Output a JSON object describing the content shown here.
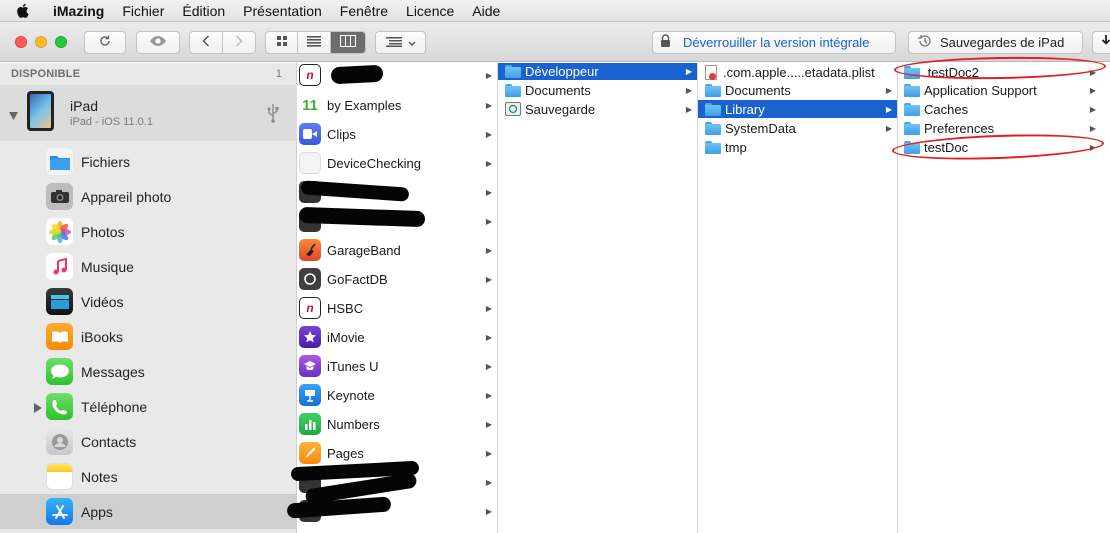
{
  "menubar": {
    "items": [
      "iMazing",
      "Fichier",
      "Édition",
      "Présentation",
      "Fenêtre",
      "Licence",
      "Aide"
    ]
  },
  "toolbar": {
    "unlock_label": "Déverrouiller la version intégrale",
    "backups_label": "Sauvegardes de iPad",
    "colors": {
      "accent": "#1a62cf",
      "close": "#fd5f57",
      "minimize": "#febc2e",
      "zoom": "#28c840"
    }
  },
  "sidebar": {
    "section_title": "DISPONIBLE",
    "count": "1",
    "device_name": "iPad",
    "device_subtitle": "iPad - iOS 11.0.1",
    "items": [
      {
        "label": "Fichiers",
        "icon": "files-icon"
      },
      {
        "label": "Appareil photo",
        "icon": "camera-icon"
      },
      {
        "label": "Photos",
        "icon": "photos-icon"
      },
      {
        "label": "Musique",
        "icon": "music-icon"
      },
      {
        "label": "Vidéos",
        "icon": "videos-icon"
      },
      {
        "label": "iBooks",
        "icon": "ibooks-icon"
      },
      {
        "label": "Messages",
        "icon": "messages-icon"
      },
      {
        "label": "Téléphone",
        "icon": "phone-icon"
      },
      {
        "label": "Contacts",
        "icon": "contacts-icon"
      },
      {
        "label": "Notes",
        "icon": "notes-icon"
      },
      {
        "label": "Apps",
        "icon": "appstore-icon"
      }
    ]
  },
  "columns": {
    "apps": [
      {
        "label": "",
        "icon": "n-app-icon"
      },
      {
        "label": "by Examples",
        "icon": "by-examples-icon"
      },
      {
        "label": "Clips",
        "icon": "clips-icon"
      },
      {
        "label": "DeviceChecking",
        "icon": "devicechecking-icon"
      },
      {
        "label": "",
        "icon": "redacted-app-icon"
      },
      {
        "label": "",
        "icon": "redacted-app-icon"
      },
      {
        "label": "GarageBand",
        "icon": "garageband-icon"
      },
      {
        "label": "GoFactDB",
        "icon": "gofactdb-icon"
      },
      {
        "label": "HSBC",
        "icon": "hsbc-icon"
      },
      {
        "label": "iMovie",
        "icon": "imovie-icon"
      },
      {
        "label": "iTunes U",
        "icon": "itunes-u-icon"
      },
      {
        "label": "Keynote",
        "icon": "keynote-icon"
      },
      {
        "label": "Numbers",
        "icon": "numbers-icon"
      },
      {
        "label": "Pages",
        "icon": "pages-icon"
      },
      {
        "label": "",
        "icon": "redacted-app-icon"
      },
      {
        "label": "",
        "icon": "redacted-app-icon"
      }
    ],
    "containers": [
      {
        "label": "Développeur",
        "selected": true
      },
      {
        "label": "Documents"
      },
      {
        "label": "Sauvegarde"
      }
    ],
    "files": [
      {
        "label": ".com.apple.....etadata.plist"
      },
      {
        "label": "Documents"
      },
      {
        "label": "Library",
        "selected": true
      },
      {
        "label": "SystemData"
      },
      {
        "label": "tmp"
      }
    ],
    "library": [
      {
        "label": ".testDoc2"
      },
      {
        "label": "Application Support"
      },
      {
        "label": "Caches"
      },
      {
        "label": "Preferences"
      },
      {
        "label": "testDoc"
      }
    ]
  }
}
